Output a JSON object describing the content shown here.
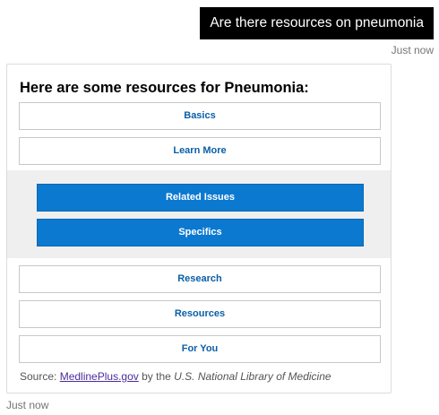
{
  "user_message": {
    "text": "Are there resources on pneumonia",
    "timestamp": "Just now"
  },
  "bot_message": {
    "title": "Here are some resources for Pneumonia:",
    "buttons": [
      {
        "label": "Basics"
      },
      {
        "label": "Learn More"
      }
    ],
    "expanded_buttons": [
      {
        "label": "Related Issues"
      },
      {
        "label": "Specifics"
      }
    ],
    "more_buttons": [
      {
        "label": "Research"
      },
      {
        "label": "Resources"
      },
      {
        "label": "For You"
      }
    ],
    "source": {
      "prefix": "Source:",
      "link_text": "MedlinePlus.gov",
      "middle": "by the",
      "org": "U.S. National Library of Medicine"
    },
    "timestamp": "Just now"
  },
  "colors": {
    "user_bubble_bg": "#000000",
    "link_text": "#0a5fa8",
    "active_button_bg": "#0b79d0",
    "expanded_bg": "#efefef"
  }
}
